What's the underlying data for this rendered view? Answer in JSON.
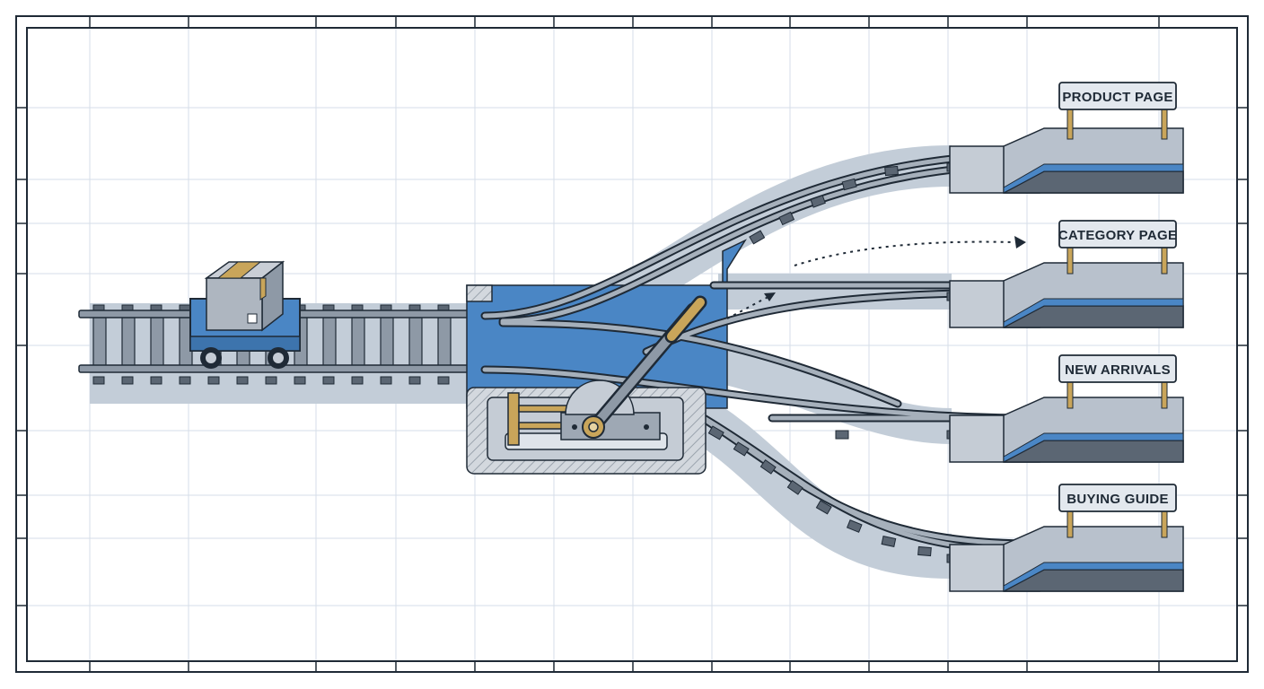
{
  "destinations": [
    {
      "label": "PRODUCT PAGE"
    },
    {
      "label": "CATEGORY PAGE"
    },
    {
      "label": "NEW ARRIVALS"
    },
    {
      "label": "BUYING GUIDE"
    }
  ],
  "icons": {
    "cart": "package-cart-icon",
    "switch": "switch-lever-icon"
  },
  "colors": {
    "accent_blue": "#4a86c5",
    "rail_gray": "#5b6673",
    "bed_shadow": "#c3cdd8",
    "platform_face": "#c5ccd5",
    "grid": "#d5dde8",
    "outline": "#1f2a36",
    "brass": "#c9a55a"
  }
}
